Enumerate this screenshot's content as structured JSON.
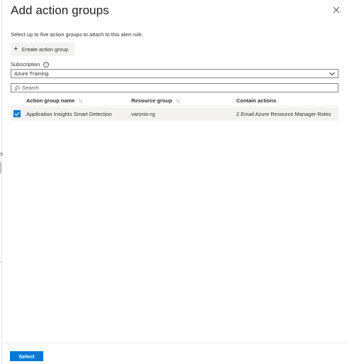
{
  "background_fragment": {
    "text": "s"
  },
  "header": {
    "title": "Add action groups",
    "close_icon": "close-icon"
  },
  "description": "Select up to five action groups to attach to this alert rule.",
  "toolbar": {
    "create_label": "Create action group",
    "create_icon": "plus-icon"
  },
  "subscription": {
    "label": "Subscription",
    "info_icon": "info-icon",
    "selected": "Azure Training"
  },
  "search": {
    "placeholder": "Search",
    "icon": "search-icon"
  },
  "table": {
    "columns": [
      {
        "label": "Action group name",
        "sort": "↑↓"
      },
      {
        "label": "Resource group",
        "sort": "↑↓"
      },
      {
        "label": "Contain actions",
        "sort": ""
      }
    ],
    "rows": [
      {
        "checked": true,
        "name": "Application Insights Smart Detection",
        "resource_group": "varonis-rg",
        "actions": "2 Email Azure Resource Manager Roles"
      }
    ]
  },
  "footer": {
    "select_label": "Select"
  },
  "colors": {
    "accent": "#0078d4",
    "row_selected_bg": "#f3f2f1",
    "border": "#8a8886"
  }
}
